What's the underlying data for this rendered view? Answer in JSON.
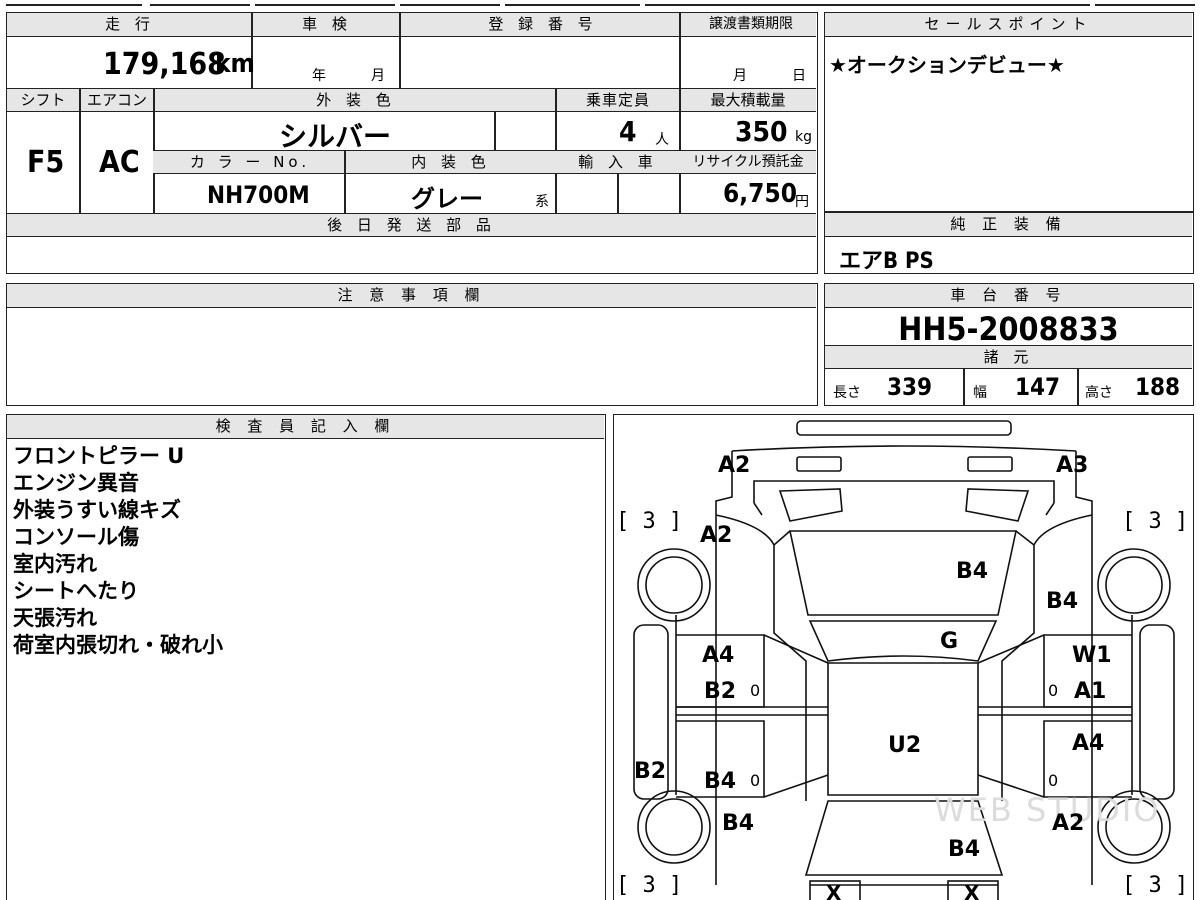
{
  "header": {
    "mileage_label": "走 行",
    "shaken_label": "車 検",
    "reg_no_label": "登 録 番 号",
    "transfer_deadline_label": "譲渡書類期限",
    "mileage_value": "179,168",
    "mileage_unit": "km",
    "year_label": "年",
    "month_label": "月",
    "tr_month_label": "月",
    "tr_day_label": "日"
  },
  "specs": {
    "shift_label": "シフト",
    "ac_label": "エアコン",
    "exterior_color_label": "外 装 色",
    "capacity_label": "乗車定員",
    "max_load_label": "最大積載量",
    "shift_value": "F5",
    "ac_value": "AC",
    "exterior_color_value": "シルバー",
    "capacity_value": "4",
    "capacity_unit": "人",
    "max_load_value": "350",
    "max_load_unit": "kg",
    "color_no_label": "カ ラ ー No.",
    "interior_color_label": "内 装 色",
    "import_label": "輸 入 車",
    "recycle_label": "リサイクル預託金",
    "color_no_value": "NH700M",
    "interior_color_value": "グレー",
    "interior_color_suffix": "系",
    "recycle_value": "6,750",
    "recycle_unit": "円"
  },
  "later_parts": {
    "label": "後 日 発 送 部 品"
  },
  "sales_point": {
    "label": "セールスポイント",
    "text": "★オークションデビュー★"
  },
  "genuine_equipment": {
    "label": "純 正 装 備",
    "text": "エアB PS"
  },
  "caution": {
    "label": "注 意 事 項 欄"
  },
  "chassis": {
    "label": "車 台 番 号",
    "value": "HH5-2008833"
  },
  "dimensions": {
    "label": "諸 元",
    "length_label": "長さ",
    "length_value": "339",
    "width_label": "幅",
    "width_value": "147",
    "height_label": "高さ",
    "height_value": "188"
  },
  "inspector": {
    "label": "検 査 員 記 入 欄",
    "notes": [
      "フロントピラー U",
      "エンジン異音",
      "外装うすい線キズ",
      "コンソール傷",
      "室内汚れ",
      "シートへたり",
      "天張汚れ",
      "荷室内張切れ・破れ小"
    ]
  },
  "diagram": {
    "watermark": "WEB STUDIO",
    "marks": {
      "front_left": "A2",
      "front_right": "A3",
      "fender_left": "A2",
      "bonnet": "B4",
      "fender_right": "B4",
      "windshield": "G",
      "front_door_left_top": "A4",
      "front_door_left_bottom": "B2",
      "front_door_right_top": "W1",
      "front_door_right_bottom": "A1",
      "roof": "U2",
      "rear_door_right": "A4",
      "sill_left": "B2",
      "rear_door_left": "B4",
      "quarter_left": "B4",
      "quarter_right": "A2",
      "back_door": "B4",
      "zero_1": "0",
      "zero_2": "0",
      "zero_3": "0",
      "zero_4": "0",
      "x_left": "X",
      "x_right": "X"
    },
    "tire_marks": {
      "front_left": "[ 3 ]",
      "front_right": "[ 3 ]",
      "rear_left": "[ 3 ]",
      "rear_right": "[ 3 ]"
    }
  }
}
